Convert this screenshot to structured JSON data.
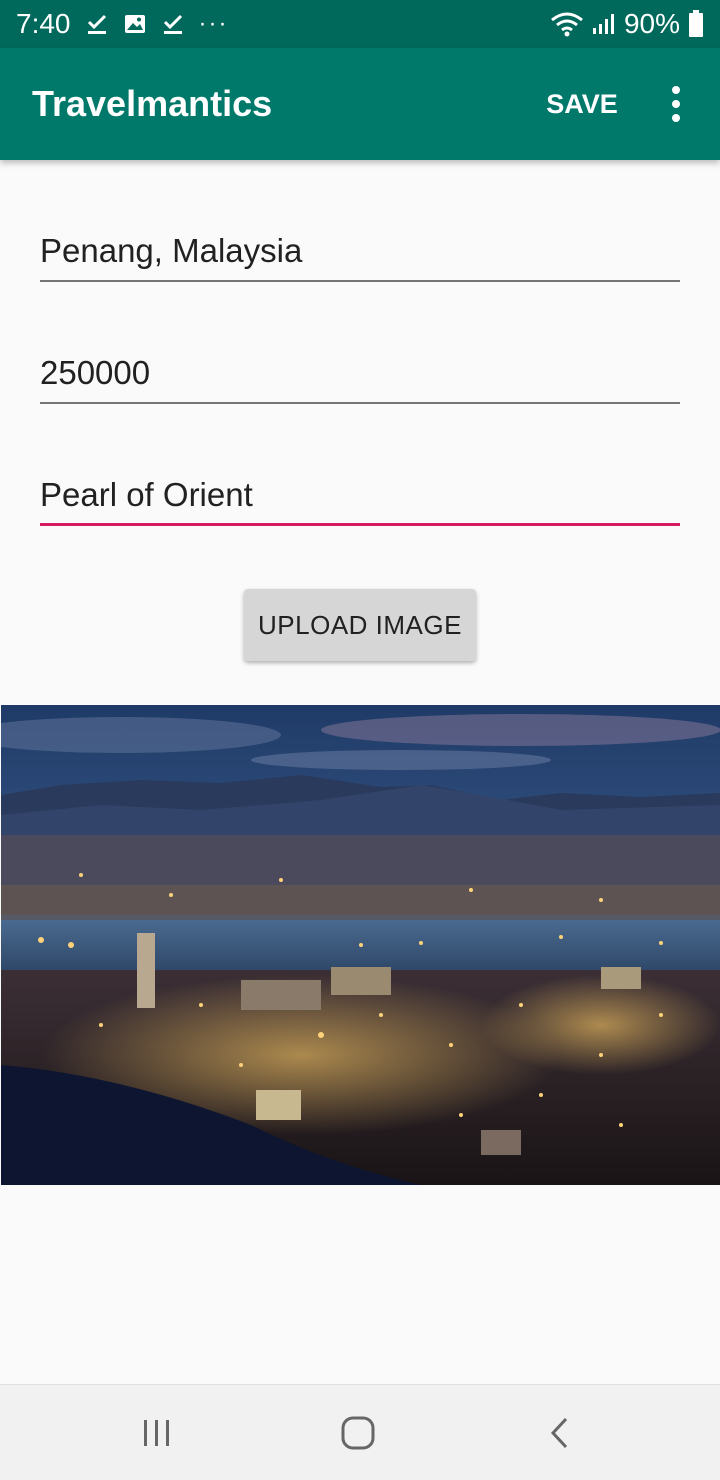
{
  "status_bar": {
    "time": "7:40",
    "overflow_indicator": "···",
    "battery": "90%",
    "icons": [
      "check-download-icon",
      "image-icon",
      "check-download-icon",
      "wifi-icon",
      "signal-icon",
      "battery-icon"
    ]
  },
  "app_bar": {
    "title": "Travelmantics",
    "save_label": "SAVE",
    "overflow_icon": "more-vert-icon",
    "color": "#00796b",
    "status_color": "#00695c"
  },
  "form": {
    "title_value": "Penang, Malaysia",
    "price_value": "250000",
    "description_value": "Pearl of Orient",
    "focus_color": "#d81b60"
  },
  "upload_button": {
    "label": "UPLOAD IMAGE"
  },
  "nav_bar": {
    "icons": [
      "recents-icon",
      "home-icon",
      "back-icon"
    ]
  }
}
